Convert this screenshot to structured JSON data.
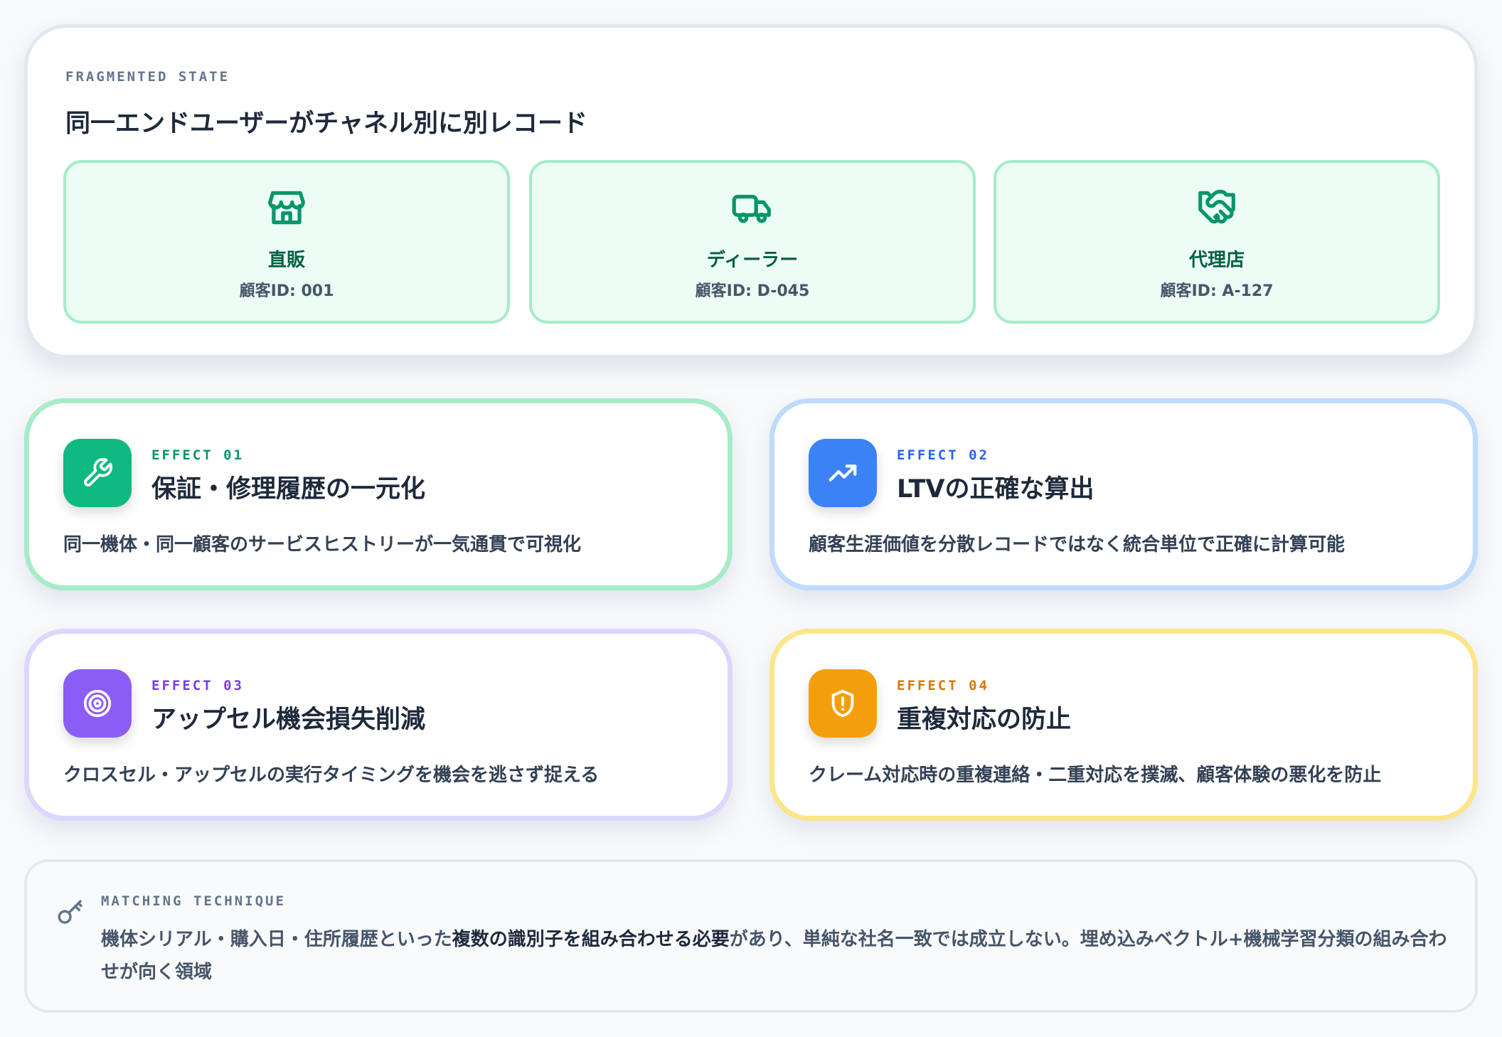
{
  "fragmented": {
    "eyebrow": "FRAGMENTED STATE",
    "title": "同一エンドユーザーがチャネル別に別レコード",
    "channels": [
      {
        "icon": "store-icon",
        "name": "直販",
        "id": "顧客ID: 001"
      },
      {
        "icon": "truck-icon",
        "name": "ディーラー",
        "id": "顧客ID: D-045"
      },
      {
        "icon": "handshake-icon",
        "name": "代理店",
        "id": "顧客ID: A-127"
      }
    ]
  },
  "effects": [
    {
      "label": "EFFECT 01",
      "title": "保証・修理履歴の一元化",
      "desc": "同一機体・同一顧客のサービスヒストリーが一気通貫で可視化",
      "icon": "wrench-icon",
      "color": "#10b981",
      "border": "#a7ebc9"
    },
    {
      "label": "EFFECT 02",
      "title": "LTVの正確な算出",
      "desc": "顧客生涯価値を分散レコードではなく統合単位で正確に計算可能",
      "icon": "trending-up-icon",
      "color": "#3b82f6",
      "border": "#bfdbfe"
    },
    {
      "label": "EFFECT 03",
      "title": "アップセル機会損失削減",
      "desc": "クロスセル・アップセルの実行タイミングを機会を逃さず捉える",
      "icon": "target-icon",
      "color": "#8b5cf6",
      "border": "#ddd6fe"
    },
    {
      "label": "EFFECT 04",
      "title": "重複対応の防止",
      "desc": "クレーム対応時の重複連絡・二重対応を撲滅、顧客体験の悪化を防止",
      "icon": "shield-alert-icon",
      "color": "#f59e0b",
      "border": "#fde68a"
    }
  ],
  "matching": {
    "eyebrow": "MATCHING TECHNIQUE",
    "text_pre": "機体シリアル・購入日・住所履歴といった",
    "text_strong": "複数の識別子を組み合わせる必要",
    "text_post": "があり、単純な社名一致では成立しない。埋め込みベクトル+機械学習分類の組み合わせが向く領域",
    "icon": "key-icon"
  },
  "colors": {
    "effect01_label": "#059669",
    "effect02_label": "#2563eb",
    "effect03_label": "#7c3aed",
    "effect04_label": "#d97706",
    "channel_icon": "#059669"
  }
}
